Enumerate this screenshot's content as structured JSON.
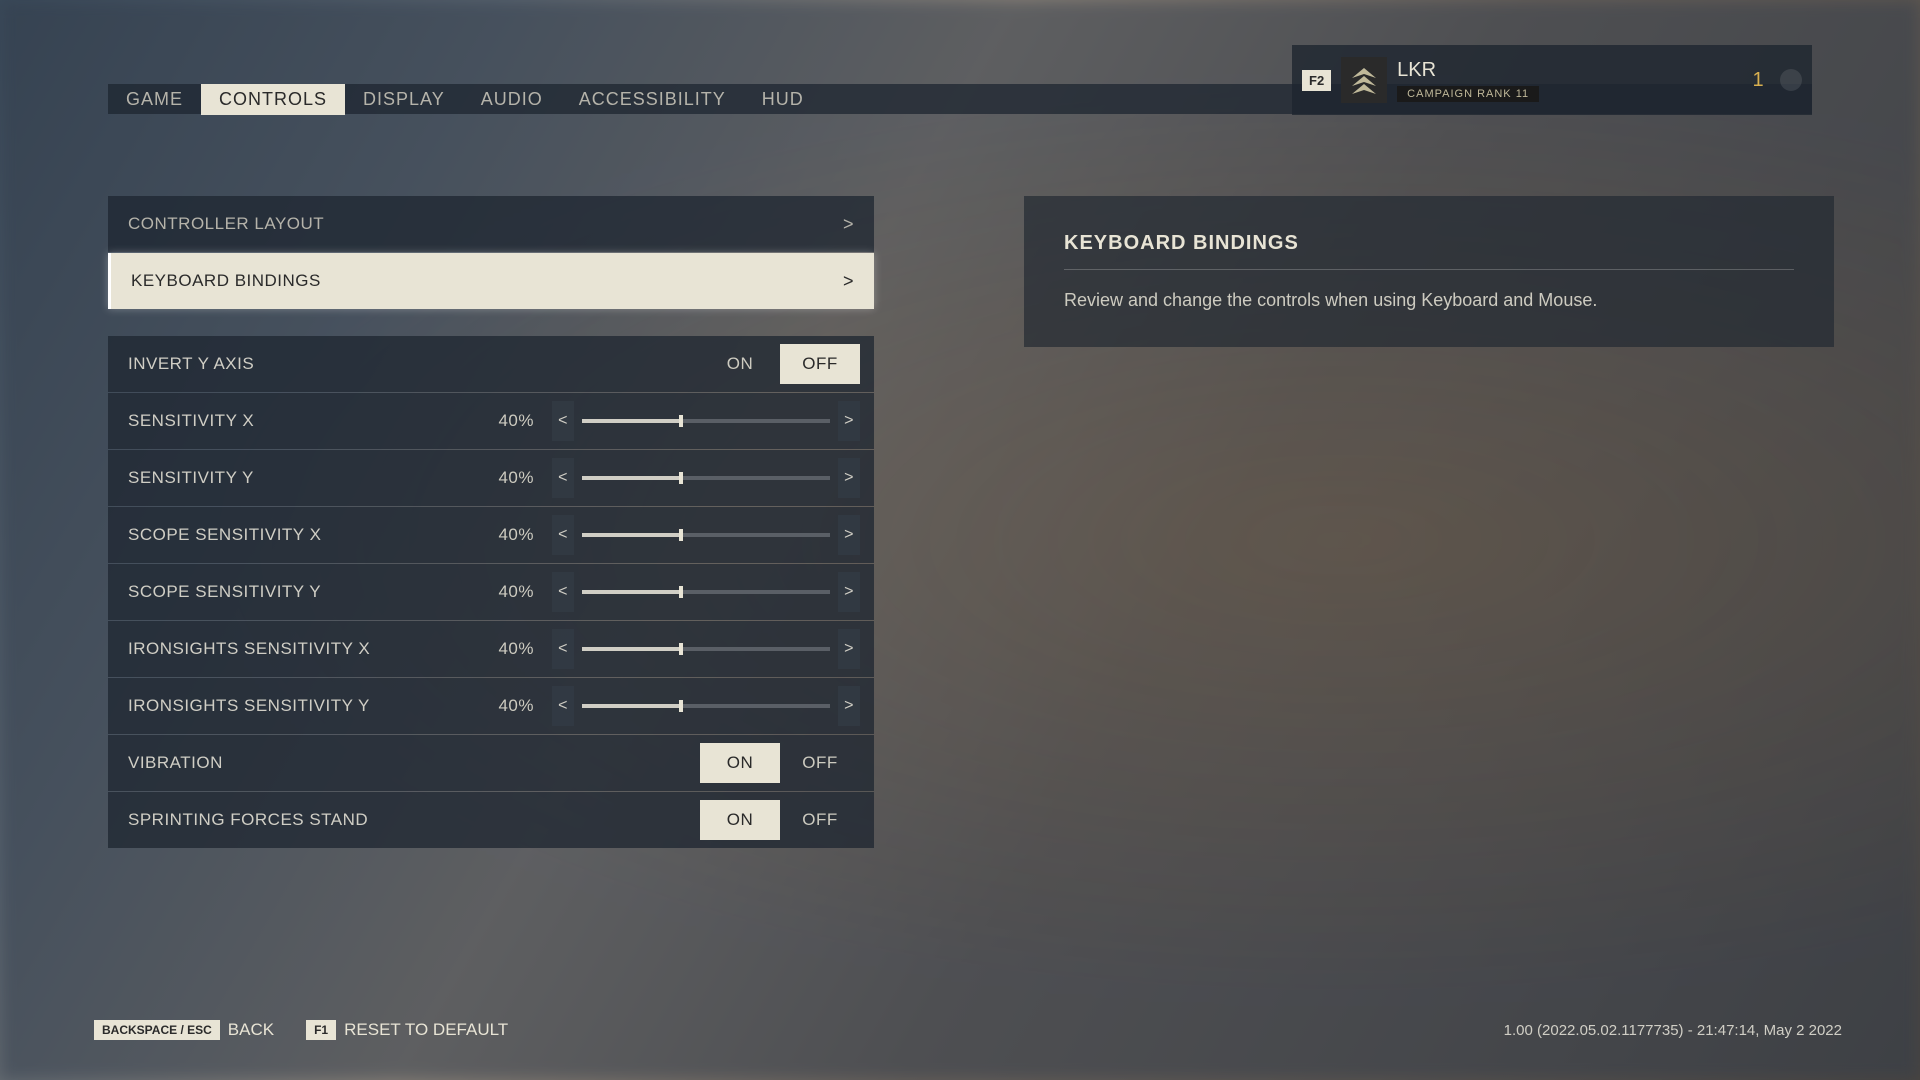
{
  "nav": {
    "tabs": [
      "GAME",
      "CONTROLS",
      "DISPLAY",
      "AUDIO",
      "ACCESSIBILITY",
      "HUD"
    ],
    "active": 1
  },
  "player": {
    "keyhint": "F2",
    "name": "LKR",
    "rank_label": "CAMPAIGN RANK 11",
    "level": "1"
  },
  "settings": {
    "nav_items": [
      {
        "label": "CONTROLLER LAYOUT",
        "selected": false
      },
      {
        "label": "KEYBOARD BINDINGS",
        "selected": true
      }
    ],
    "rows": [
      {
        "label": "INVERT Y AXIS",
        "type": "toggle",
        "value": "OFF",
        "options": [
          "ON",
          "OFF"
        ]
      },
      {
        "label": "SENSITIVITY X",
        "type": "slider",
        "value": 40,
        "display": "40%"
      },
      {
        "label": "SENSITIVITY Y",
        "type": "slider",
        "value": 40,
        "display": "40%"
      },
      {
        "label": "SCOPE SENSITIVITY X",
        "type": "slider",
        "value": 40,
        "display": "40%"
      },
      {
        "label": "SCOPE SENSITIVITY Y",
        "type": "slider",
        "value": 40,
        "display": "40%"
      },
      {
        "label": "IRONSIGHTS SENSITIVITY X",
        "type": "slider",
        "value": 40,
        "display": "40%"
      },
      {
        "label": "IRONSIGHTS SENSITIVITY Y",
        "type": "slider",
        "value": 40,
        "display": "40%"
      },
      {
        "label": "VIBRATION",
        "type": "toggle",
        "value": "ON",
        "options": [
          "ON",
          "OFF"
        ]
      },
      {
        "label": "SPRINTING FORCES STAND",
        "type": "toggle",
        "value": "ON",
        "options": [
          "ON",
          "OFF"
        ]
      }
    ]
  },
  "info": {
    "title": "KEYBOARD BINDINGS",
    "desc": "Review and change the controls when using Keyboard and Mouse."
  },
  "footer": {
    "back_key": "BACKSPACE / ESC",
    "back_label": "BACK",
    "reset_key": "F1",
    "reset_label": "RESET TO DEFAULT",
    "version": "1.00 (2022.05.02.1177735) - 21:47:14, May  2 2022"
  },
  "glyphs": {
    "left": "<",
    "right": ">"
  }
}
